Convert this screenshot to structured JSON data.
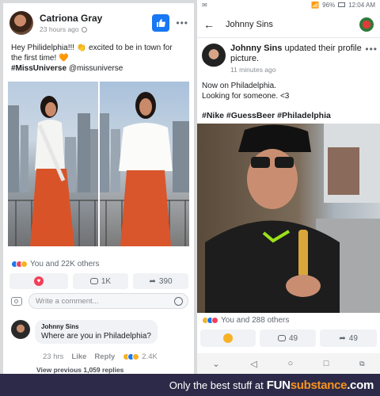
{
  "left_post": {
    "author": "Catriona Gray",
    "time": "23 hours ago",
    "line1": "Hey Philidelphia!!! 👏 excited to be in town for",
    "line2": "the first time! 🧡",
    "hashtag": "#MissUniverse",
    "mention": "@missuniverse",
    "reactions_text": "You and 22K others",
    "comment_count": "1K",
    "share_count": "390",
    "comment_placeholder": "Write a comment...",
    "comment": {
      "author": "Johnny Sins",
      "text": "Where are you in Philadelphia?",
      "age": "23 hrs",
      "like": "Like",
      "reply": "Reply",
      "reaction_count": "2.4K",
      "view_previous": "View previous 1,059 replies"
    }
  },
  "right_post": {
    "status_bar": {
      "battery": "96%",
      "time": "12:04 AM"
    },
    "nav_title": "Johnny Sins",
    "author": "Johnny Sins",
    "action_text": "updated their profile picture.",
    "time": "11 minutes ago",
    "line1": "Now on Philadelphia.",
    "line2": "Looking for someone. <3",
    "hashtags": "#Nike #GuessBeer #Philadelphia",
    "reactions_text": "You and 288 others",
    "comment_count": "49",
    "share_count": "49"
  },
  "footer": {
    "text": "Only the best stuff at",
    "brand_a": "FUN",
    "brand_b": "substance",
    "brand_c": ".com"
  },
  "colors": {
    "facebook_blue": "#1877f2",
    "footer_bg": "#2c2a48",
    "brand_orange": "#f7931e"
  }
}
